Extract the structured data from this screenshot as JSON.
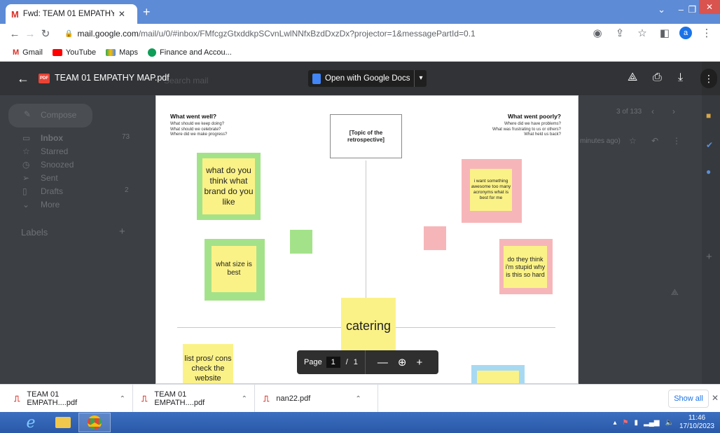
{
  "browser": {
    "tab_title": "Fwd: TEAM 01 EMPATHY MAP.pd",
    "url_host": "mail.google.com",
    "url_path": "/mail/u/0/#inbox/FMfcgzGtxddkpSCvnLwlNNfxBzdDxzDx?projector=1&messagePartId=0.1",
    "profile_initial": "a",
    "bookmarks": [
      "Gmail",
      "YouTube",
      "Maps",
      "Finance and Accou..."
    ]
  },
  "gmail": {
    "search_placeholder": "Search mail",
    "compose": "Compose",
    "nav": [
      {
        "label": "Inbox",
        "count": "73"
      },
      {
        "label": "Starred",
        "count": ""
      },
      {
        "label": "Snoozed",
        "count": ""
      },
      {
        "label": "Sent",
        "count": ""
      },
      {
        "label": "Drafts",
        "count": "2"
      },
      {
        "label": "More",
        "count": ""
      }
    ],
    "labels_heading": "Labels",
    "pagination": "3 of 133",
    "time_ago": "minutes ago)"
  },
  "viewer": {
    "file_title": "TEAM 01 EMPATHY MAP.pdf",
    "open_with": "Open with Google Docs",
    "page_label": "Page",
    "page_current": "1",
    "page_sep": "/",
    "page_total": "1"
  },
  "pdf": {
    "left_heading": "What went well?",
    "left_sub": [
      "What should we keep doing?",
      "What should we celebrate?",
      "Where did we make progress?"
    ],
    "right_heading": "What went poorly?",
    "right_sub": [
      "Where did we have problems?",
      "What was frustrating to us or others?",
      "What held us back?"
    ],
    "topic": "[Topic of the retrospective]",
    "notes": {
      "brand": "what do you think what brand do you like",
      "size": "what size is best",
      "awesome": "i want something awesome too many acronyms what is best for me",
      "stupid": "do they think i'm stupid why is this so hard",
      "catering": "catering",
      "pros": "list pros/ cons check the website"
    }
  },
  "downloads": {
    "items": [
      "TEAM 01 EMPATH....pdf",
      "TEAM 01 EMPATH....pdf",
      "nan22.pdf"
    ],
    "show_all": "Show all"
  },
  "taskbar": {
    "time": "11:46",
    "date": "17/10/2023"
  },
  "colors": {
    "tabstrip": "#5d8bd6",
    "note_yellow": "#fbf287",
    "note_green": "#a4e28a",
    "note_pink": "#f6b6b9",
    "note_blue": "#a8d9f2"
  }
}
